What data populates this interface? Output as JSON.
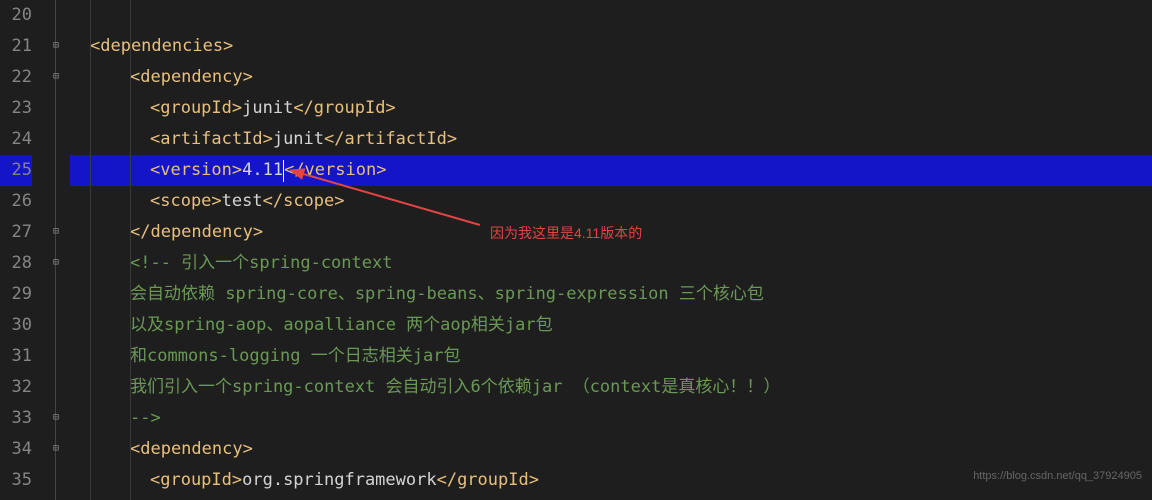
{
  "lines": {
    "20": "20",
    "21": "21",
    "22": "22",
    "23": "23",
    "24": "24",
    "25": "25",
    "26": "26",
    "27": "27",
    "28": "28",
    "29": "29",
    "30": "30",
    "31": "31",
    "32": "32",
    "33": "33",
    "34": "34",
    "35": "35"
  },
  "code": {
    "l21_open": "<dependencies>",
    "l22_open": "<dependency>",
    "l23_open": "<groupId>",
    "l23_text": "junit",
    "l23_close": "</groupId>",
    "l24_open": "<artifactId>",
    "l24_text": "junit",
    "l24_close": "</artifactId>",
    "l25_open": "<version>",
    "l25_text": "4.11",
    "l25_close": "</version>",
    "l26_open": "<scope>",
    "l26_text": "test",
    "l26_close": "</scope>",
    "l27_close": "</dependency>",
    "l28": "<!-- 引入一个spring-context",
    "l29": "会自动依赖   spring-core、spring-beans、spring-expression   三个核心包",
    "l30": "以及spring-aop、aopalliance                                   两个aop相关jar包",
    "l31": "和commons-logging                                   一个日志相关jar包",
    "l32": "我们引入一个spring-context 会自动引入6个依赖jar       （context是真核心！！）",
    "l33": "-->",
    "l34_open": "<dependency>",
    "l35_open": "<groupId>",
    "l35_text": "org.springframework",
    "l35_close": "</groupId>"
  },
  "annotation": {
    "text": "因为我这里是4.11版本的"
  },
  "watermark": "https://blog.csdn.net/qq_37924905"
}
